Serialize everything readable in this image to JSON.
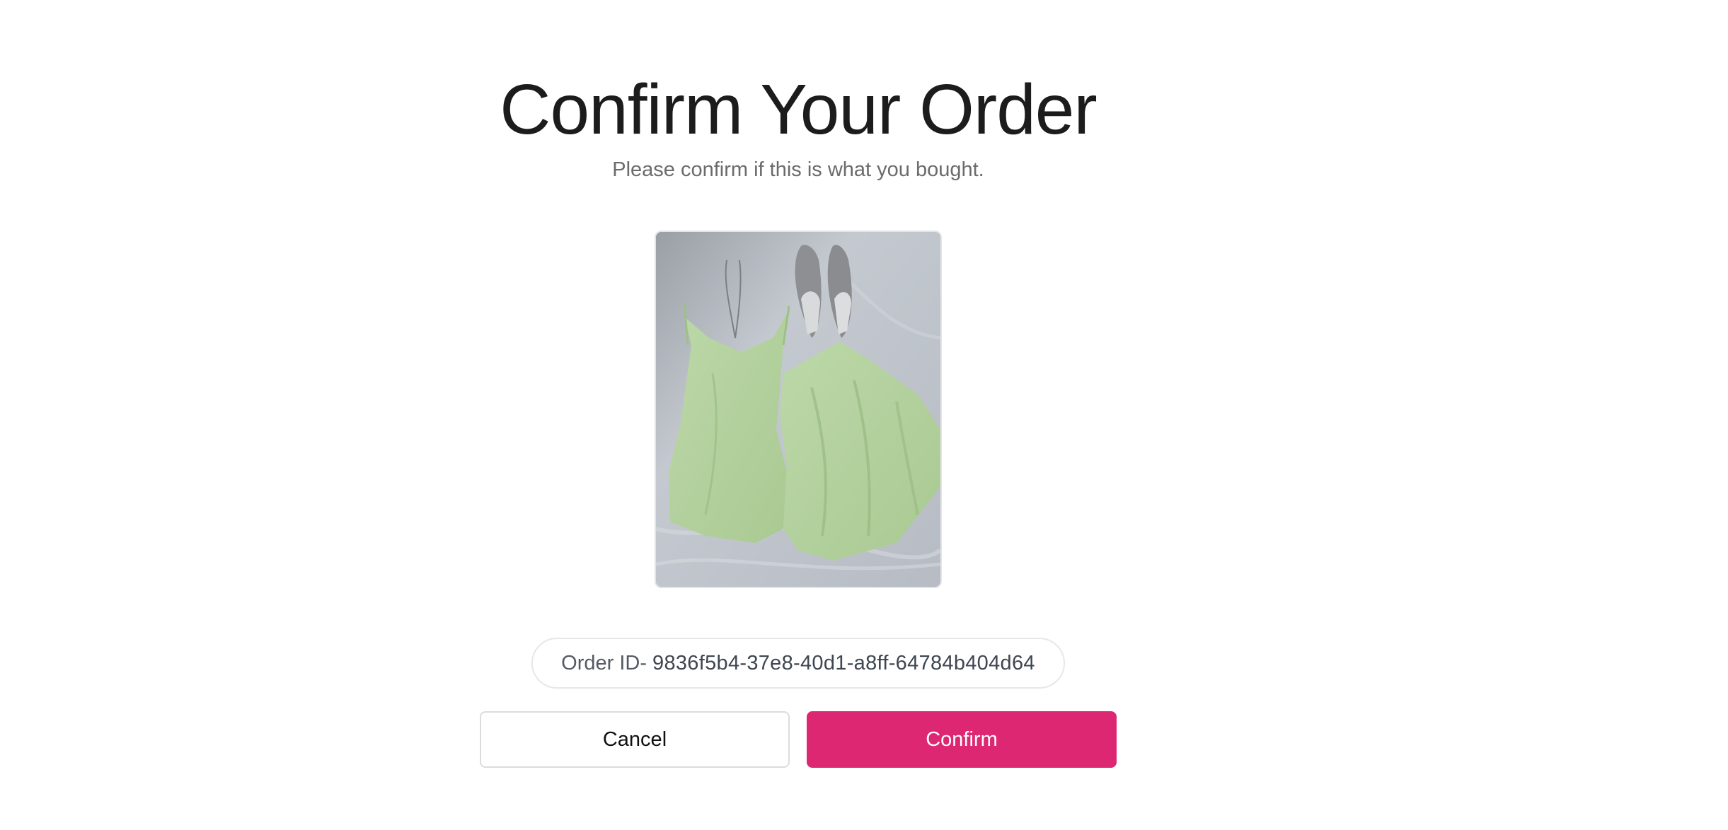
{
  "header": {
    "title": "Confirm Your Order",
    "subtitle": "Please confirm if this is what you bought."
  },
  "product": {
    "image_description_icon": "product-photo"
  },
  "order": {
    "label": "Order ID-",
    "id": "9836f5b4-37e8-40d1-a8ff-64784b404d64"
  },
  "actions": {
    "cancel_label": "Cancel",
    "confirm_label": "Confirm"
  },
  "colors": {
    "accent": "#dd2773",
    "title": "#1c1c1c",
    "subtitle": "#6b6b6b"
  }
}
